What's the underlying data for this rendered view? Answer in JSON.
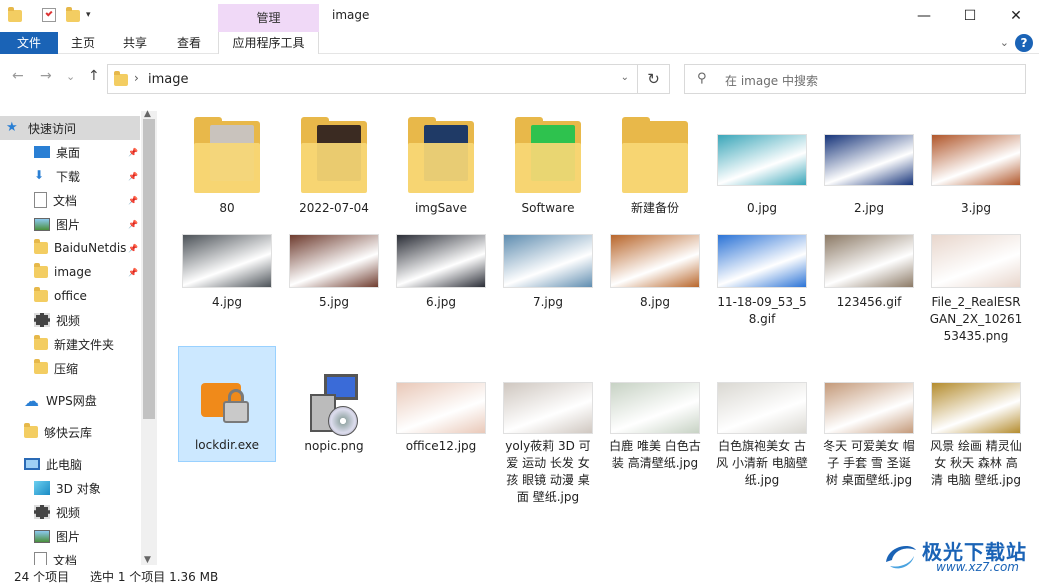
{
  "title_bar": {
    "context_tab": "管理",
    "window_title": "image",
    "minimize": "—",
    "maximize": "☐",
    "close": "✕"
  },
  "ribbon": {
    "tabs": [
      "文件",
      "主页",
      "共享",
      "查看",
      "应用程序工具"
    ],
    "help": "?"
  },
  "address": {
    "back": "←",
    "forward": "→",
    "recent": "⌄",
    "up": "↑",
    "path": "image",
    "refresh": "↻"
  },
  "search": {
    "placeholder": "在 image 中搜索"
  },
  "sidebar": {
    "items": [
      {
        "label": "快速访问",
        "icon": "star-icon",
        "pinned": false,
        "selected": true
      },
      {
        "label": "桌面",
        "icon": "desktop-icon",
        "pinned": true
      },
      {
        "label": "下载",
        "icon": "download-icon",
        "pinned": true
      },
      {
        "label": "文档",
        "icon": "document-icon",
        "pinned": true
      },
      {
        "label": "图片",
        "icon": "picture-icon",
        "pinned": true
      },
      {
        "label": "BaiduNetdis",
        "icon": "folder-icon",
        "pinned": true
      },
      {
        "label": "image",
        "icon": "folder-icon",
        "pinned": true
      },
      {
        "label": "office",
        "icon": "folder-icon",
        "pinned": false
      },
      {
        "label": "视频",
        "icon": "video-icon",
        "pinned": false
      },
      {
        "label": "新建文件夹",
        "icon": "folder-icon",
        "pinned": false
      },
      {
        "label": "压缩",
        "icon": "folder-icon",
        "pinned": false
      },
      {
        "label": "WPS网盘",
        "icon": "cloud-icon",
        "pinned": false
      },
      {
        "label": "够快云库",
        "icon": "folder-icon",
        "pinned": false
      },
      {
        "label": "此电脑",
        "icon": "computer-icon",
        "pinned": false
      },
      {
        "label": "3D 对象",
        "icon": "cube-icon",
        "pinned": false
      },
      {
        "label": "视频",
        "icon": "video-icon",
        "pinned": false
      },
      {
        "label": "图片",
        "icon": "picture-icon",
        "pinned": false
      },
      {
        "label": "文档",
        "icon": "document-icon",
        "pinned": false
      }
    ]
  },
  "files": [
    {
      "name": "80",
      "kind": "folder",
      "color": "#c9c3bd"
    },
    {
      "name": "2022-07-04",
      "kind": "folder",
      "color": "#3b2b22"
    },
    {
      "name": "imgSave",
      "kind": "folder",
      "color": "#1f3a66"
    },
    {
      "name": "Software",
      "kind": "folder",
      "color": "#2ec24e"
    },
    {
      "name": "新建备份",
      "kind": "folder",
      "color": ""
    },
    {
      "name": "0.jpg",
      "kind": "image",
      "color": "#3aa6b9"
    },
    {
      "name": "2.jpg",
      "kind": "image",
      "color": "#16347a"
    },
    {
      "name": "3.jpg",
      "kind": "image",
      "color": "#b0562a"
    },
    {
      "name": "4.jpg",
      "kind": "image",
      "color": "#4c5258"
    },
    {
      "name": "5.jpg",
      "kind": "image",
      "color": "#6e3b2e"
    },
    {
      "name": "6.jpg",
      "kind": "image",
      "color": "#2a2d36"
    },
    {
      "name": "7.jpg",
      "kind": "image",
      "color": "#5f8db0"
    },
    {
      "name": "8.jpg",
      "kind": "image",
      "color": "#b8662b"
    },
    {
      "name": "11-18-09_53_58.gif",
      "kind": "image",
      "color": "#2b73d6"
    },
    {
      "name": "123456.gif",
      "kind": "image",
      "color": "#8c7a66"
    },
    {
      "name": "File_2_RealESRGAN_2X_1026153435.png",
      "kind": "image",
      "color": "#e8d6cc"
    },
    {
      "name": "lockdir.exe",
      "kind": "exe",
      "color": "#f08a1a"
    },
    {
      "name": "nopic.png",
      "kind": "setup",
      "color": "#3a6bd8"
    },
    {
      "name": "office12.jpg",
      "kind": "image",
      "color": "#e9c8b8"
    },
    {
      "name": "yoly莜莉 3D 可爱 运动 长发 女孩 眼镜 动漫 桌面 壁纸.jpg",
      "kind": "image",
      "color": "#cfc7c0"
    },
    {
      "name": "白鹿 唯美 白色古装 高清壁纸.jpg",
      "kind": "image",
      "color": "#c7d2c4"
    },
    {
      "name": "白色旗袍美女 古风 小清新 电脑壁纸.jpg",
      "kind": "image",
      "color": "#dad8d2"
    },
    {
      "name": "冬天 可爱美女 帽子 手套 雪 圣诞树 桌面壁纸.jpg",
      "kind": "image",
      "color": "#c49a7a"
    },
    {
      "name": "风景 绘画 精灵仙女 秋天 森林 高清 电脑 壁纸.jpg",
      "kind": "image",
      "color": "#b48c2e"
    }
  ],
  "selected_file": "lockdir.exe",
  "status": {
    "count": "24 个项目",
    "selection": "选中 1 个项目  1.36 MB"
  },
  "watermark": {
    "title": "极光下载站",
    "url": "www.xz7.com"
  },
  "colors": {
    "accent": "#1a63b6",
    "context_tab": "#f0d9f7",
    "selection": "#cce8ff"
  }
}
